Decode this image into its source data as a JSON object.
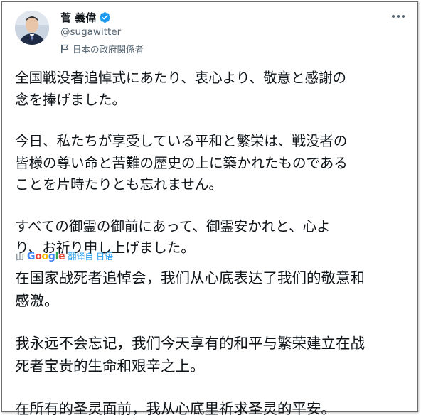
{
  "author": {
    "name": "菅 義偉",
    "handle": "@sugawitter",
    "label": "日本の政府関係者",
    "verified_color": "#1d9bf0"
  },
  "icons": {
    "more": "more-options-icon",
    "verified": "verified-badge-icon",
    "label": "flag-icon",
    "translate": "translate-icon"
  },
  "tweet": {
    "paragraphs": [
      "全国戦没者追悼式にあたり、衷心より、敬意と感謝の\n念を捧げました。",
      "今日、私たちが享受している平和と繁栄は、戦没者の\n皆様の尊い命と苦難の歴史の上に築かれたものである\nことを片時たりとも忘れません。",
      "すべての御霊の御前にあって、御霊安かれと、心よ\nり、お祈り申し上げました。"
    ]
  },
  "translate": {
    "by": "由",
    "provider": "Google",
    "link": "翻译自 日语"
  },
  "translation": {
    "paragraphs": [
      "在国家战死者追悼会，我们从心底表达了我们的敬意和\n感激。",
      "我永远不会忘记，我们今天享有的和平与繁荣建立在战\n死者宝贵的生命和艰辛之上。",
      "在所有的圣灵面前，我从心底里祈求圣灵的平安。"
    ]
  }
}
